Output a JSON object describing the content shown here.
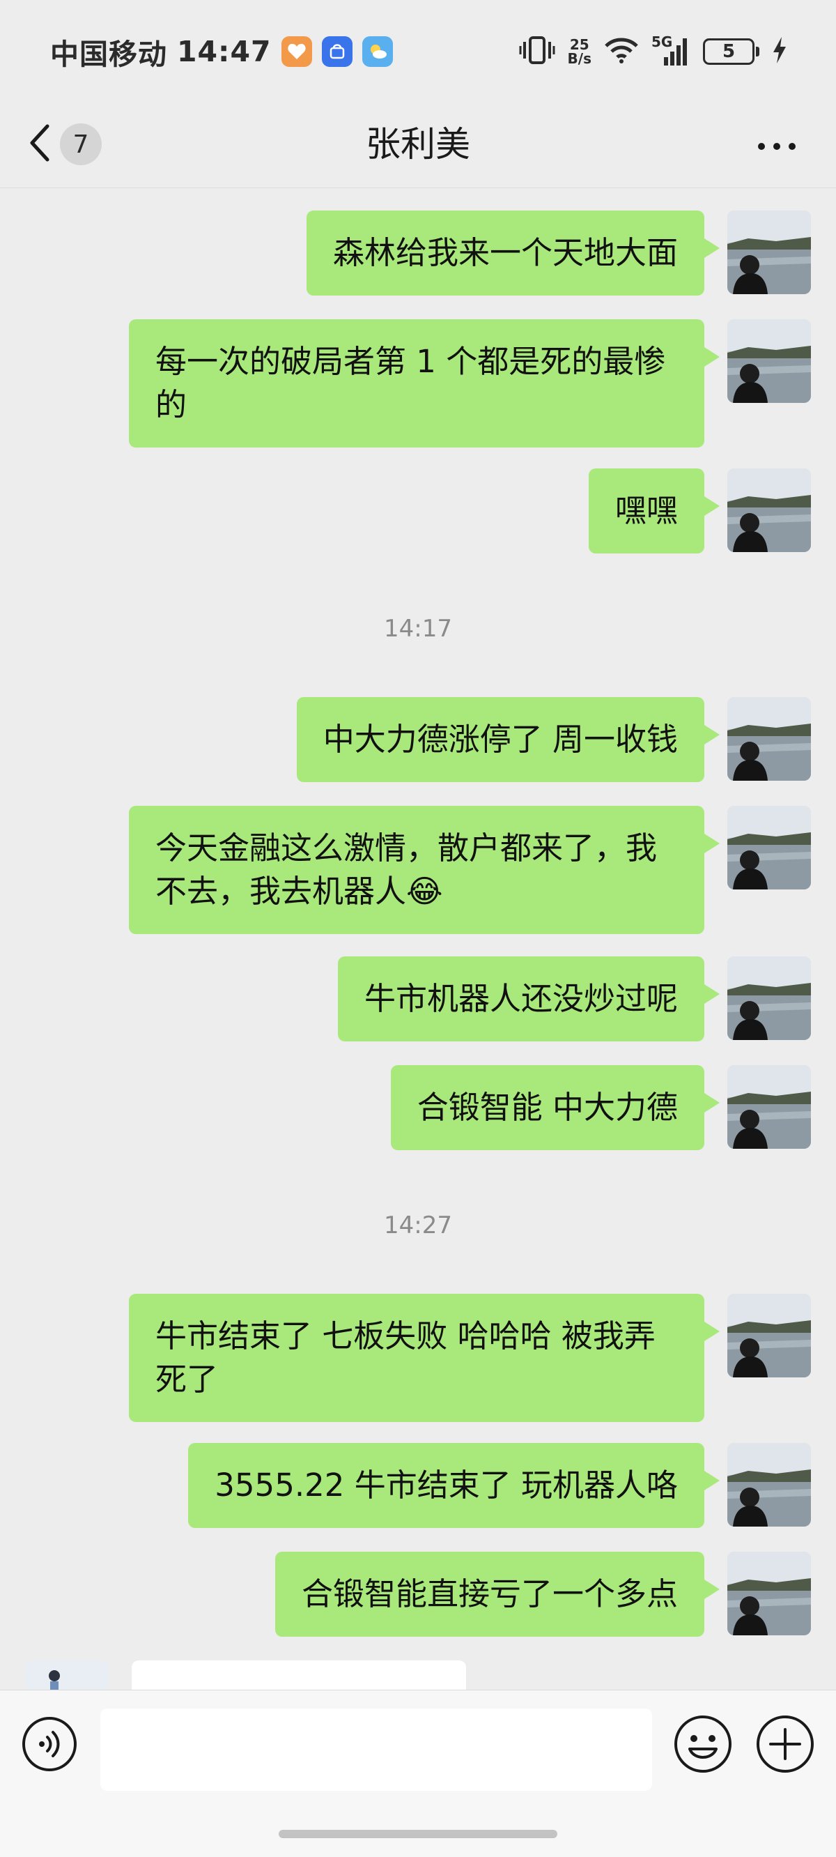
{
  "status_bar": {
    "carrier": "中国移动",
    "time": "14:47",
    "net_speed_value": "25",
    "net_speed_unit": "B/s",
    "signal_label": "5G",
    "battery_level": "5",
    "icons": [
      "vibrate-icon",
      "wifi-icon",
      "signal-icon",
      "battery-icon",
      "charging-icon"
    ],
    "app_icons": [
      "health-app-icon",
      "honor-app-icon",
      "weather-app-icon"
    ]
  },
  "nav": {
    "unread_count": "7",
    "title": "张利美",
    "back_icon": "chevron-left-icon",
    "more_icon": "more-icon"
  },
  "messages": [
    {
      "type": "text",
      "sender": "me",
      "text": "森林给我来一个天地大面"
    },
    {
      "type": "text",
      "sender": "me",
      "text": "每一次的破局者第 1 个都是死的最惨的"
    },
    {
      "type": "text",
      "sender": "me",
      "text": "嘿嘿"
    },
    {
      "type": "time",
      "text": "14:17"
    },
    {
      "type": "text",
      "sender": "me",
      "text": "中大力德涨停了 周一收钱"
    },
    {
      "type": "text",
      "sender": "me",
      "text": "今天金融这么激情，散户都来了，我不去，我去机器人😂"
    },
    {
      "type": "text",
      "sender": "me",
      "text": "牛市机器人还没炒过呢"
    },
    {
      "type": "text",
      "sender": "me",
      "text": "合锻智能 中大力德"
    },
    {
      "type": "time",
      "text": "14:27"
    },
    {
      "type": "text",
      "sender": "me",
      "text": "牛市结束了 七板失败 哈哈哈 被我弄死了"
    },
    {
      "type": "text",
      "sender": "me",
      "text": "3555.22 牛市结束了 玩机器人咯"
    },
    {
      "type": "text",
      "sender": "me",
      "text": "合锻智能直接亏了一个多点"
    }
  ],
  "input_bar": {
    "placeholder": "",
    "voice_icon": "voice-icon",
    "emoji_icon": "emoji-icon",
    "plus_icon": "plus-icon"
  },
  "colors": {
    "background": "#ededed",
    "bubble_me": "#a9e97c",
    "bubble_other": "#ffffff",
    "timestamp": "#8a8a8a"
  }
}
